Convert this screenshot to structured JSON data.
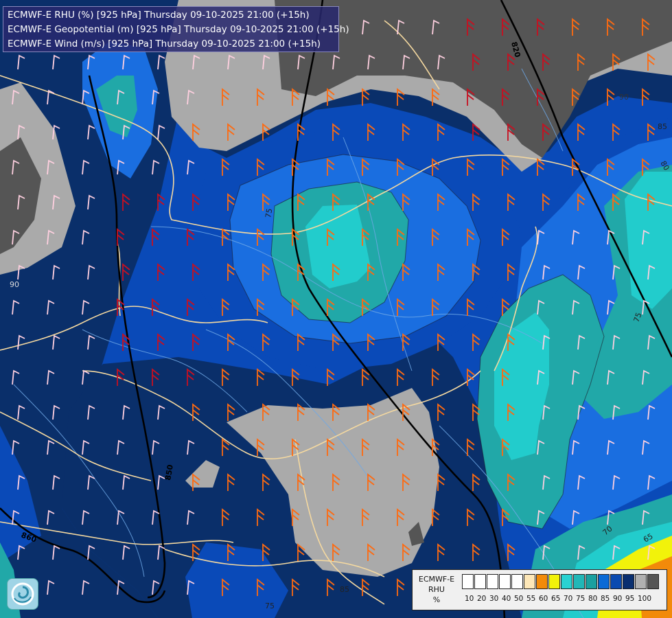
{
  "title_lines": [
    "ECMWF-E RHU (%) [925 hPa] Thursday 09-10-2025 21:00 (+15h)",
    "ECMWF-E Geopotential (m) [925 hPa] Thursday 09-10-2025 21:00 (+15h)",
    "ECMWF-E Wind (m/s) [925 hPa] Thursday 09-10-2025 21:00 (+15h)"
  ],
  "legend": {
    "model": "ECMWF-E",
    "variable": "RHU",
    "unit": "%",
    "ticks": [
      "10",
      "20",
      "30",
      "40",
      "50",
      "55",
      "60",
      "65",
      "70",
      "75",
      "80",
      "85",
      "90",
      "95",
      "100"
    ],
    "colors": [
      "#ffffff",
      "#ffffff",
      "#ffffff",
      "#ffffff",
      "#ffffff",
      "#fde7b8",
      "#f28a0a",
      "#f2f20a",
      "#2ad2d2",
      "#22b7b7",
      "#1aa0a0",
      "#0a6ad6",
      "#0a4ab0",
      "#0a2f70",
      "#b0b0b0",
      "#555555"
    ]
  },
  "contour_labels": [
    "820",
    "850",
    "860",
    "90",
    "85",
    "80",
    "75",
    "70",
    "65",
    "85",
    "90",
    "75",
    "75"
  ],
  "colors": {
    "rhu_100": "#555555",
    "rhu_95": "#aaaaaa",
    "rhu_90": "#0a2f6a",
    "rhu_85": "#0a4ab8",
    "rhu_80": "#1a6ee0",
    "rhu_75": "#21a8a8",
    "rhu_70": "#22cccc",
    "rhu_65": "#f2f20a",
    "rhu_60": "#f28a0a",
    "border": "#f5d9a0",
    "river": "#6fa8e6",
    "isohypse": "#000000",
    "barb_orange": "#ff6a10",
    "barb_red": "#c81020",
    "barb_pink": "#ffd0e0"
  },
  "logo_icon": "ecmwf-swirl-icon"
}
